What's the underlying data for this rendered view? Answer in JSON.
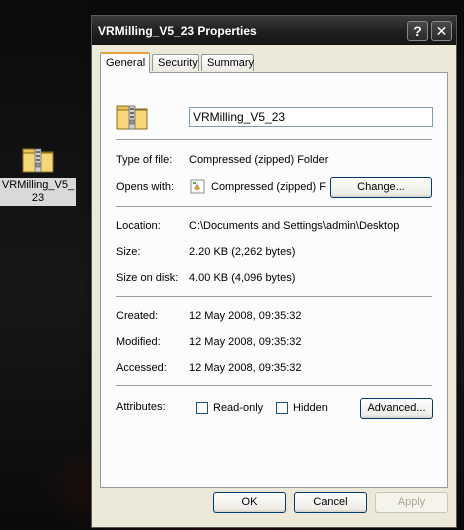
{
  "desktop": {
    "icon_label": "VRMilling_V5_23"
  },
  "window": {
    "title": "VRMilling_V5_23 Properties",
    "help_glyph": "?",
    "close_glyph": "✕"
  },
  "tabs": [
    {
      "label": "General"
    },
    {
      "label": "Security"
    },
    {
      "label": "Summary"
    }
  ],
  "general": {
    "name_value": "VRMilling_V5_23",
    "type_label": "Type of file:",
    "type_value": "Compressed (zipped) Folder",
    "opens_label": "Opens with:",
    "opens_value": "Compressed (zipped) F",
    "change_button": "Change...",
    "location_label": "Location:",
    "location_value": "C:\\Documents and Settings\\admin\\Desktop",
    "size_label": "Size:",
    "size_value": "2.20 KB (2,262 bytes)",
    "size_disk_label": "Size on disk:",
    "size_disk_value": "4.00 KB (4,096 bytes)",
    "created_label": "Created:",
    "created_value": "12 May 2008, 09:35:32",
    "modified_label": "Modified:",
    "modified_value": "12 May 2008, 09:35:32",
    "accessed_label": "Accessed:",
    "accessed_value": "12 May 2008, 09:35:32",
    "attributes_label": "Attributes:",
    "readonly_label": "Read-only",
    "readonly_checked": false,
    "hidden_label": "Hidden",
    "hidden_checked": false,
    "advanced_button": "Advanced..."
  },
  "footer": {
    "ok": "OK",
    "cancel": "Cancel",
    "apply": "Apply"
  },
  "icons": {
    "zip_folder": "zip-folder-icon",
    "opens_with_app": "compressed-folder-app-icon"
  },
  "colors": {
    "dialog_bg": "#ece9d8",
    "panel_bg": "#fcfcfe",
    "titlebar": "#202020",
    "tab_accent": "#e8a33d"
  }
}
